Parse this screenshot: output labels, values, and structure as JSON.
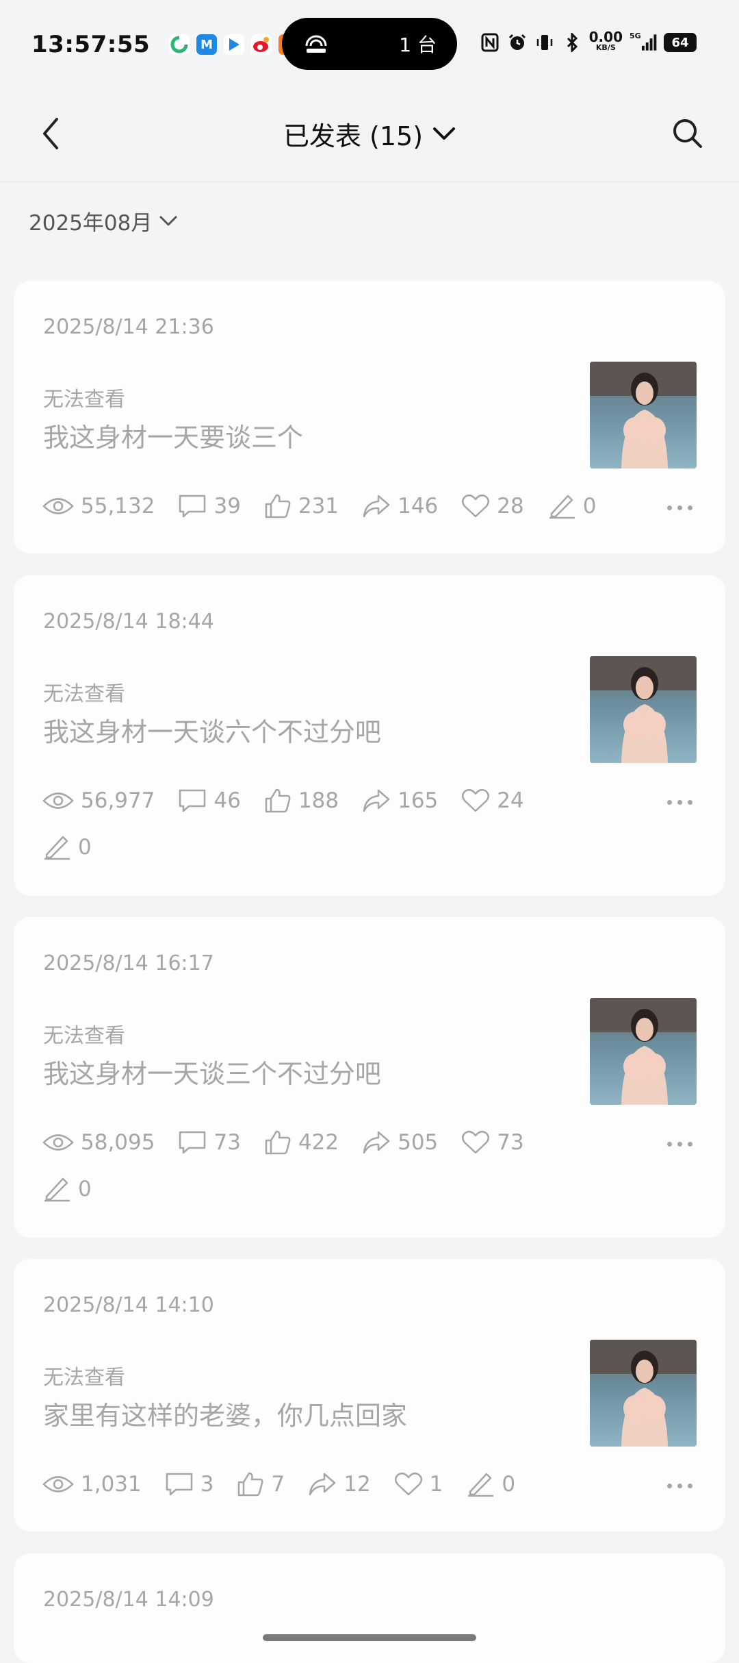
{
  "status_bar": {
    "time": "13:57:55",
    "pill_text": "1 台",
    "net_speed_value": "0.00",
    "net_speed_unit": "KB/S",
    "signal_label": "5G",
    "battery": "64"
  },
  "header": {
    "title": "已发表 (15)"
  },
  "filter": {
    "month": "2025年08月"
  },
  "posts": [
    {
      "date": "2025/8/14 21:36",
      "status": "无法查看",
      "text": "我这身材一天要谈三个",
      "views": "55,132",
      "comments": "39",
      "likes": "231",
      "shares": "146",
      "favorites": "28",
      "edits": "0"
    },
    {
      "date": "2025/8/14 18:44",
      "status": "无法查看",
      "text": "我这身材一天谈六个不过分吧",
      "views": "56,977",
      "comments": "46",
      "likes": "188",
      "shares": "165",
      "favorites": "24",
      "edits": "0"
    },
    {
      "date": "2025/8/14 16:17",
      "status": "无法查看",
      "text": "我这身材一天谈三个不过分吧",
      "views": "58,095",
      "comments": "73",
      "likes": "422",
      "shares": "505",
      "favorites": "73",
      "edits": "0"
    },
    {
      "date": "2025/8/14 14:10",
      "status": "无法查看",
      "text": "家里有这样的老婆，你几点回家",
      "views": "1,031",
      "comments": "3",
      "likes": "7",
      "shares": "12",
      "favorites": "1",
      "edits": "0"
    },
    {
      "date": "2025/8/14 14:09"
    }
  ]
}
